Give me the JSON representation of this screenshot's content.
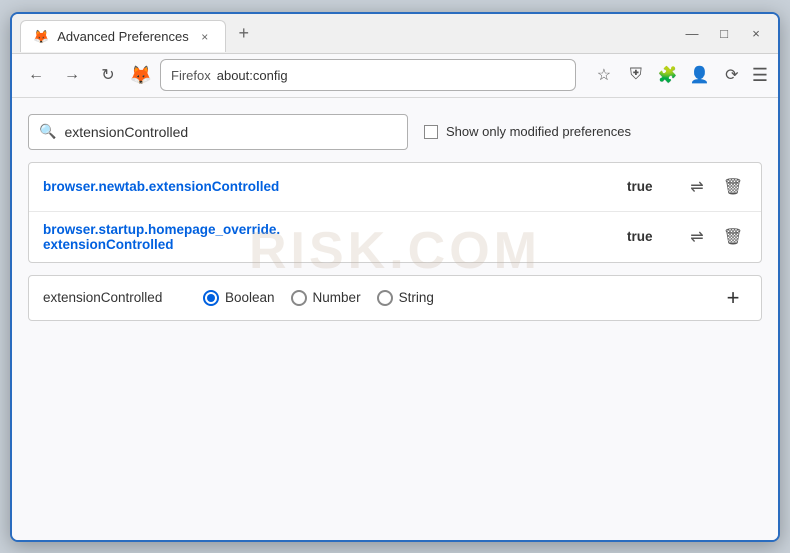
{
  "window": {
    "title": "Advanced Preferences",
    "tab_close": "×",
    "new_tab": "+",
    "controls": {
      "minimize": "—",
      "maximize": "□",
      "close": "×"
    }
  },
  "nav": {
    "back": "←",
    "forward": "→",
    "reload": "↻",
    "browser_name": "Firefox",
    "url": "about:config",
    "star": "☆",
    "shield": "⛨",
    "puzzle": "🧩",
    "profile": "👤",
    "sync": "⟳",
    "menu": "☰"
  },
  "search": {
    "placeholder": "extensionControlled",
    "show_modified_label": "Show only modified preferences"
  },
  "results": [
    {
      "name": "browser.newtab.extensionControlled",
      "value": "true"
    },
    {
      "name": "browser.startup.homepage_override.\nextensionControlled",
      "name_line1": "browser.startup.homepage_override.",
      "name_line2": "extensionControlled",
      "value": "true",
      "multiline": true
    }
  ],
  "add_pref": {
    "name": "extensionControlled",
    "types": [
      {
        "id": "boolean",
        "label": "Boolean",
        "selected": true
      },
      {
        "id": "number",
        "label": "Number",
        "selected": false
      },
      {
        "id": "string",
        "label": "String",
        "selected": false
      }
    ],
    "add_btn": "+"
  },
  "watermark": "RISK.COM",
  "icons": {
    "search": "🔍",
    "swap": "⇌",
    "delete": "🗑",
    "firefox_emoji": "🦊"
  }
}
